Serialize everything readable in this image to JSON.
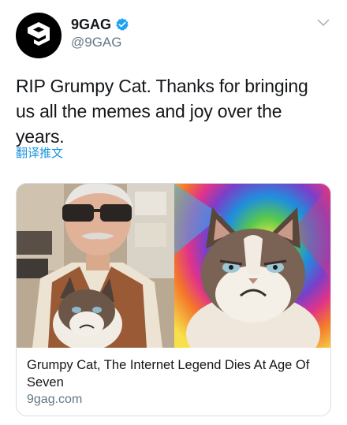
{
  "tweet": {
    "author": {
      "display_name": "9GAG",
      "handle": "@9GAG",
      "avatar_icon": "9gag-logo-icon",
      "verified": true,
      "verified_icon": "verified-badge-icon"
    },
    "text": "RIP Grumpy Cat. Thanks for bringing us all the memes and joy over the years.",
    "translate_label": "翻译推文",
    "menu_icon": "chevron-down-icon",
    "card": {
      "title": "Grumpy Cat, The Internet Legend Dies At Age Of Seven",
      "domain": "9gag.com",
      "images": [
        "man-with-cat-photo",
        "grumpy-cat-tie-dye-photo"
      ]
    }
  },
  "colors": {
    "link": "#1b95e0",
    "text": "#14171a",
    "secondary": "#657786",
    "verified": "#1da1f2",
    "border": "#d8dee3"
  }
}
